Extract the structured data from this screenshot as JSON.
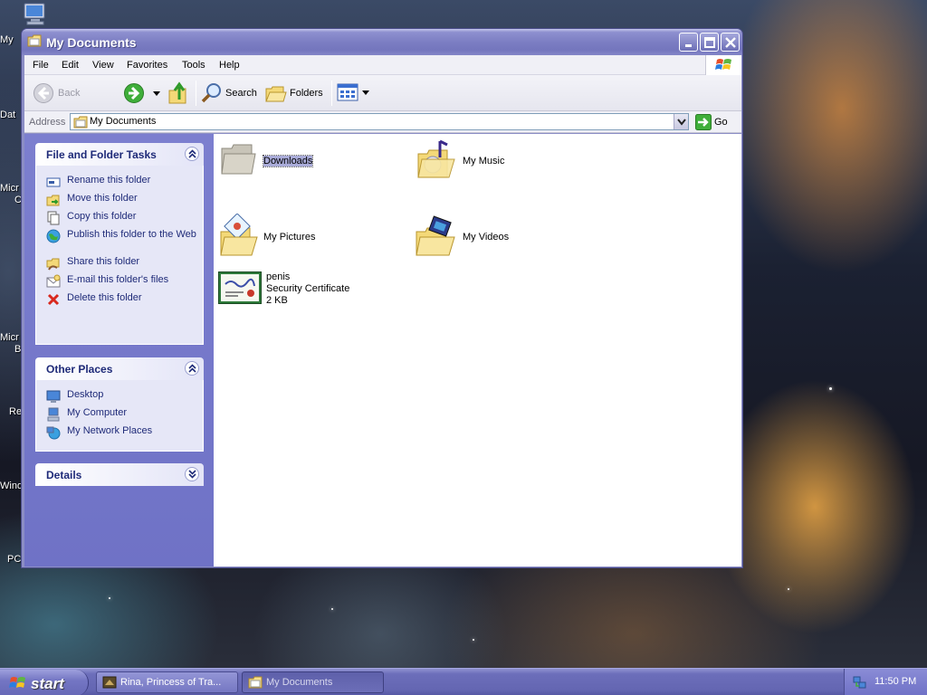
{
  "desktop": {
    "icon_labels": [
      "My",
      "Dat",
      "Micr",
      "C",
      "Micr",
      "B",
      "Re",
      "Wind",
      "PC"
    ]
  },
  "window": {
    "title": "My Documents",
    "menu": [
      "File",
      "Edit",
      "View",
      "Favorites",
      "Tools",
      "Help"
    ],
    "toolbar": {
      "back": "Back",
      "search": "Search",
      "folders": "Folders"
    },
    "address": {
      "label": "Address",
      "value": "My Documents",
      "go": "Go"
    },
    "tasks_panel": {
      "title": "File and Folder Tasks",
      "items": [
        "Rename this folder",
        "Move this folder",
        "Copy this folder",
        "Publish this folder to the Web",
        "Share this folder",
        "E-mail this folder's files",
        "Delete this folder"
      ]
    },
    "places_panel": {
      "title": "Other Places",
      "items": [
        "Desktop",
        "My Computer",
        "My Network Places"
      ]
    },
    "details_panel": {
      "title": "Details"
    },
    "files": [
      {
        "name": "Downloads",
        "icon": "folder-icon"
      },
      {
        "name": "My Music",
        "icon": "music-folder-icon"
      },
      {
        "name": "My Pictures",
        "icon": "pictures-folder-icon"
      },
      {
        "name": "My Videos",
        "icon": "videos-folder-icon"
      },
      {
        "name": "penis",
        "type": "Security Certificate",
        "size": "2 KB",
        "icon": "certificate-icon"
      }
    ]
  },
  "taskbar": {
    "start": "start",
    "buttons": [
      "Rina, Princess of Tra...",
      "My Documents"
    ],
    "clock": "11:50 PM"
  },
  "colors": {
    "titlebar": "#7c7ec3",
    "taskpane": "#7c7fcf",
    "link": "#1e2a78",
    "selection": "#a9abd8"
  }
}
